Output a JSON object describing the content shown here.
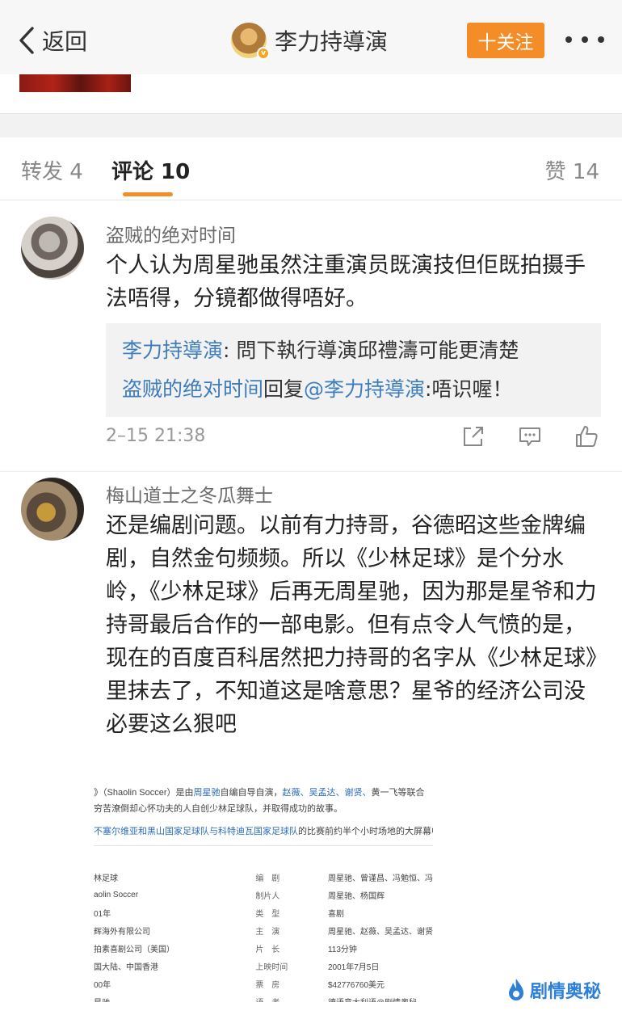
{
  "nav": {
    "back_label": "返回",
    "title": "李力持導演",
    "verified_badge": "v",
    "follow_label": "十关注",
    "more_icon": "more-dots-icon"
  },
  "tabs": {
    "repost": "转发 4",
    "comment": "评论 10",
    "like": "赞 14"
  },
  "comments": [
    {
      "author": "盗贼的绝对时间",
      "text": "个人认为周星驰虽然注重演员既演技但佢既拍摄手法唔得，分镜都做得唔好。",
      "replies": [
        {
          "author": "李力持導演",
          "sep": ": ",
          "text": "問下執行導演邱禮濤可能更清楚"
        },
        {
          "author": "盗贼的绝对时间",
          "mid": "回复",
          "mention": "@李力持導演",
          "text": ":唔识喔！"
        }
      ],
      "time": "2–15 21:38"
    },
    {
      "author": "梅山道士之冬瓜舞士",
      "text": "还是编剧问题。以前有力持哥，谷德昭这些金牌编剧，自然金句频频。所以《少林足球》是个分水岭，《少林足球》后再无周星驰，因为那是星爷和力持哥最后合作的一部电影。但有点令人气愤的是，现在的百度百科居然把力持哥的名字从《少林足球》里抹去了，不知道这是啥意思？星爷的经济公司没必要这么狠吧"
    }
  ],
  "embed": {
    "line1_a": "》（Shaolin Soccer）是由",
    "line1_b": "周星驰",
    "line1_c": "自编自导自演，",
    "line1_d": "赵薇、吴孟达、谢贤、",
    "line1_e": "黄一飞等联合",
    "line2": "穷苦潦倒却心怀功夫的人自创少林足球队，并取得成功的故事。",
    "line3_a": "不塞尔维亚和黑山国家足球队与科特迪瓦国家足球队",
    "line3_b": "的比赛前约半个小时场地的大屏幕中",
    "rows": [
      {
        "k": "林足球",
        "l": "编　剧",
        "v": "周星驰、曾谨昌、冯勉恒、冯"
      },
      {
        "k": "aolin Soccer",
        "l": "制片人",
        "v": "周星驰、杨国辉"
      },
      {
        "k": "01年",
        "l": "类　型",
        "v": "喜剧"
      },
      {
        "k": "辉海外有限公司",
        "l": "主　演",
        "v": "周星驰、赵薇、吴孟达、谢贤"
      },
      {
        "k": "拍素喜剧公司（美国）",
        "l": "片　长",
        "v": "113分钟"
      },
      {
        "k": "国大陆、中国香港",
        "l": "上映时间",
        "v": "2001年7月5日"
      },
      {
        "k": "00年",
        "l": "票　房",
        "v": "$42776760美元"
      },
      {
        "k": "星驰",
        "l": "语　者",
        "v": "德语意大利语@剧情奥秘"
      }
    ]
  },
  "watermark": "剧情奥秘"
}
